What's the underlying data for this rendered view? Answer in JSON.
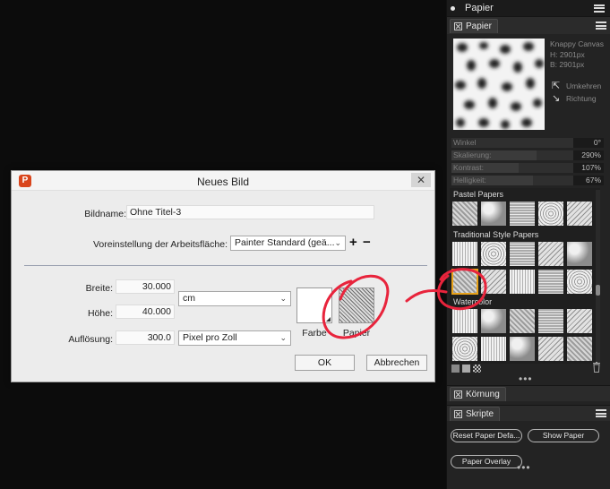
{
  "panel": {
    "title": "Papier",
    "tab_label": "Papier",
    "paper_name": "Knappy Canvas",
    "paper_height": "H: 2901px",
    "paper_width": "B: 2901px",
    "invert_label": "Umkehren",
    "direction_label": "Richtung",
    "sliders": [
      {
        "label": "Winkel",
        "value": "0°",
        "fill": 0.0
      },
      {
        "label": "Skalierung:",
        "value": "290%",
        "fill": 0.7
      },
      {
        "label": "Kontrast:",
        "value": "107%",
        "fill": 0.55
      },
      {
        "label": "Helligkeit:",
        "value": "67%",
        "fill": 0.67
      }
    ],
    "library": {
      "groups": [
        {
          "title": "Pastel Papers"
        },
        {
          "title": "Traditional Style Papers"
        },
        {
          "title": "Watercolor"
        }
      ]
    },
    "koernung_tab": "Körnung",
    "skripte_tab": "Skripte",
    "buttons": {
      "reset": "Reset Paper Defa...",
      "show": "Show Paper",
      "overlay": "Paper Overlay"
    }
  },
  "dialog": {
    "title": "Neues Bild",
    "close_glyph": "✕",
    "bildname_label": "Bildname:",
    "bildname_value": "Ohne Titel-3",
    "preset_label": "Voreinstellung der Arbeitsfläche:",
    "preset_value": "Painter Standard (geä...",
    "breite_label": "Breite:",
    "breite_value": "30.000",
    "hoehe_label": "Höhe:",
    "hoehe_value": "40.000",
    "unit_value": "cm",
    "aufloesung_label": "Auflösung:",
    "aufloesung_value": "300.0",
    "resolution_unit": "Pixel pro Zoll",
    "farbe_label": "Farbe",
    "papier_label": "Papier",
    "ok_label": "OK",
    "cancel_label": "Abbrechen",
    "plus": "+",
    "minus": "−"
  },
  "colors": {
    "annotation": "#e8243c",
    "selection": "#e8a21a"
  }
}
